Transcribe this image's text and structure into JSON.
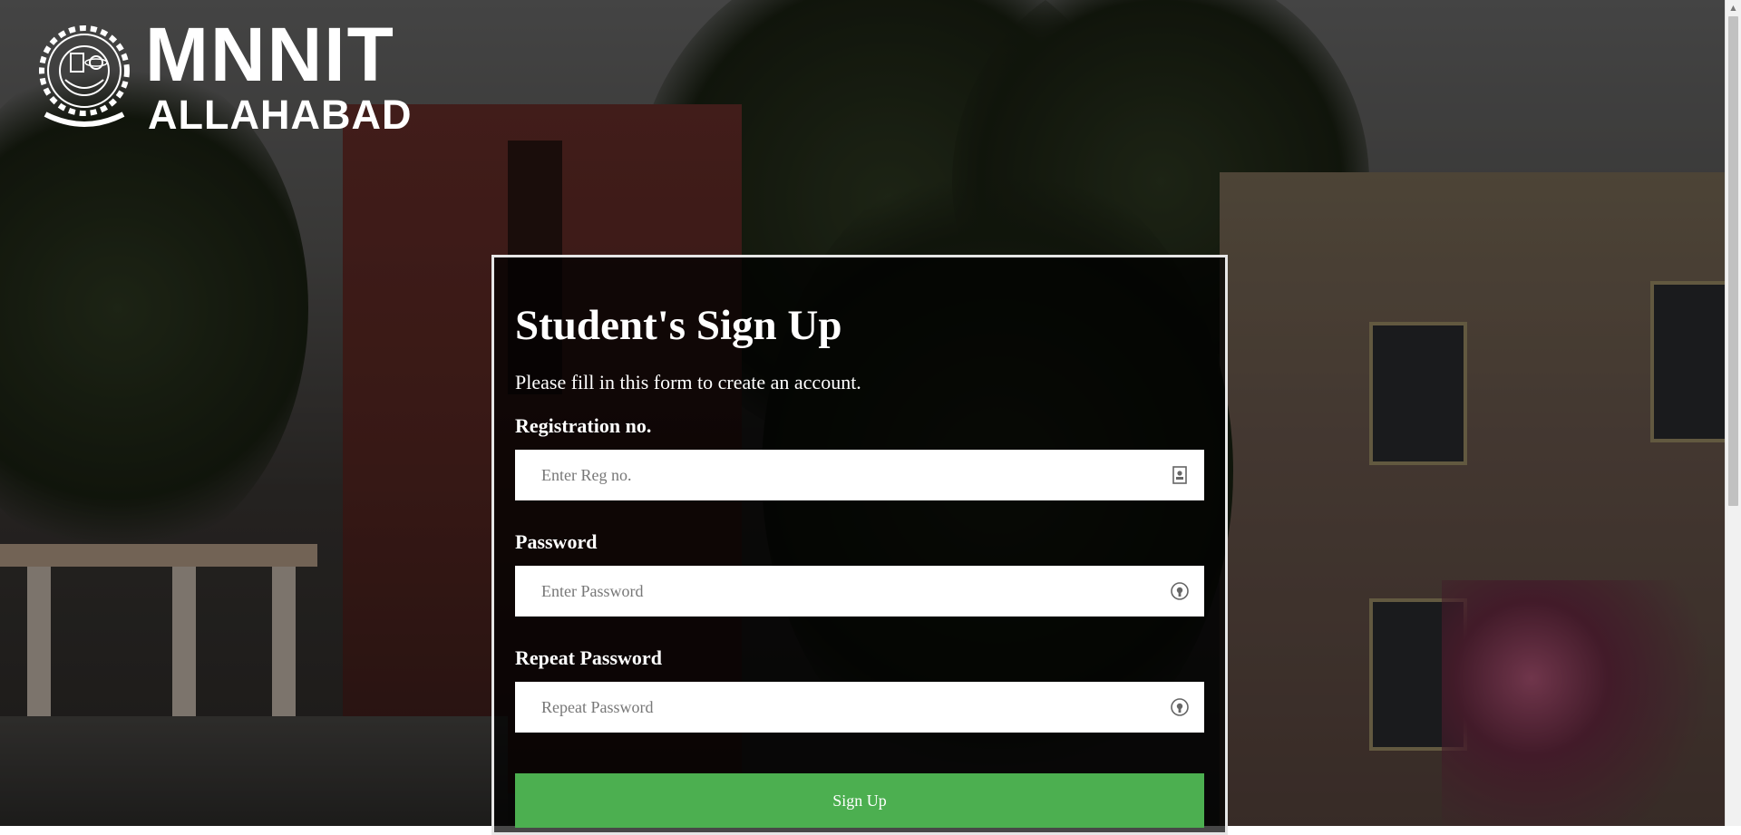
{
  "logo": {
    "name": "MNNIT",
    "city": "ALLAHABAD"
  },
  "form": {
    "title": "Student's Sign Up",
    "subtitle": "Please fill in this form to create an account.",
    "fields": [
      {
        "label": "Registration no.",
        "placeholder": "Enter Reg no.",
        "icon": "id-badge-icon"
      },
      {
        "label": "Password",
        "placeholder": "Enter Password",
        "icon": "lock-icon"
      },
      {
        "label": "Repeat Password",
        "placeholder": "Repeat Password",
        "icon": "lock-icon"
      }
    ],
    "submit_label": "Sign Up",
    "button_color": "#4caf50"
  }
}
